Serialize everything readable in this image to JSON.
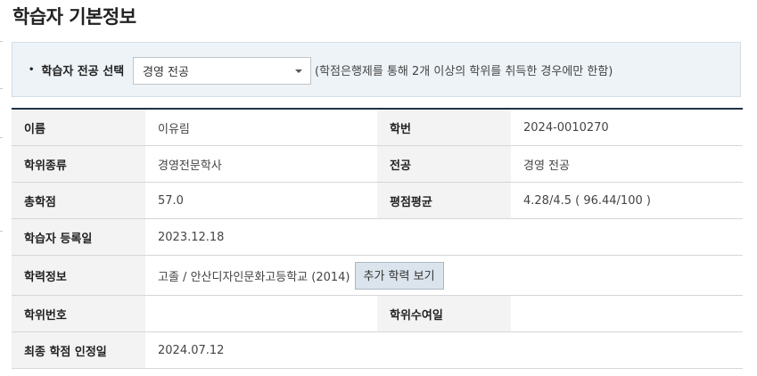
{
  "page_title": "학습자 기본정보",
  "major_selector": {
    "bullet": "•",
    "label": "학습자 전공 선택",
    "selected_value": "경영 전공",
    "note": "(학점은행제를 통해 2개 이상의 학위를 취득한 경우에만 한함)"
  },
  "info": {
    "name_label": "이름",
    "name_value": "이유림",
    "student_id_label": "학번",
    "student_id_value": "2024-0010270",
    "degree_type_label": "학위종류",
    "degree_type_value": "경영전문학사",
    "major_label": "전공",
    "major_value": "경영 전공",
    "total_credits_label": "총학점",
    "total_credits_value": "57.0",
    "gpa_label": "평점평균",
    "gpa_value": "4.28/4.5 ( 96.44/100 )",
    "registration_date_label": "학습자 등록일",
    "registration_date_value": "2023.12.18",
    "education_label": "학력정보",
    "education_value": "고졸 / 안산디자인문화고등학교 (2014)",
    "more_education_button": "추가 학력 보기",
    "degree_number_label": "학위번호",
    "degree_number_value": "",
    "degree_award_date_label": "학위수여일",
    "degree_award_date_value": "",
    "final_credit_date_label": "최종 학점 인정일",
    "final_credit_date_value": "2024.07.12"
  }
}
